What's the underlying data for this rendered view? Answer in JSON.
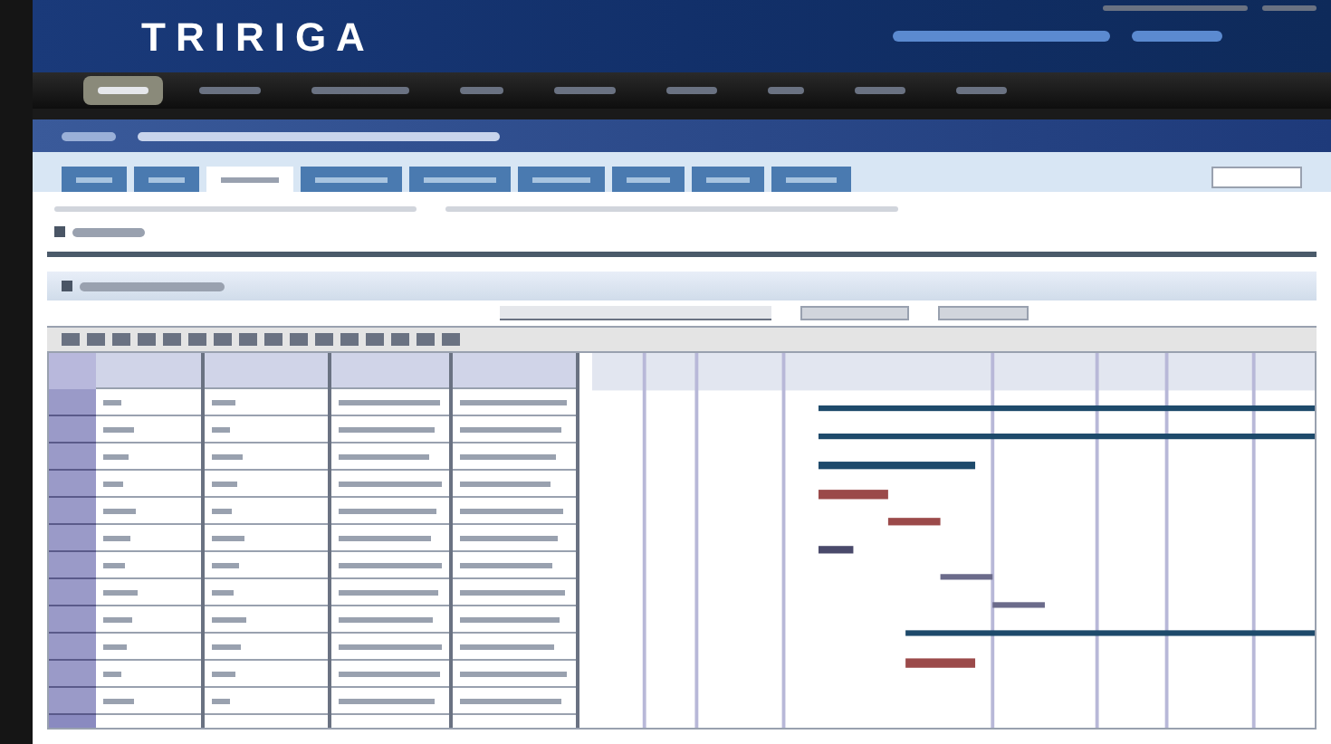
{
  "header": {
    "logo": "TRIRIGA"
  },
  "nav": {
    "items": [
      {
        "selected": true
      },
      {
        "selected": false
      },
      {
        "selected": false
      },
      {
        "selected": false
      },
      {
        "selected": false
      },
      {
        "selected": false
      },
      {
        "selected": false
      },
      {
        "selected": false
      },
      {
        "selected": false
      }
    ]
  },
  "tabs": [
    {
      "selected": false
    },
    {
      "selected": false
    },
    {
      "selected": true
    },
    {
      "selected": false
    },
    {
      "selected": false
    },
    {
      "selected": false
    },
    {
      "selected": false
    },
    {
      "selected": false
    },
    {
      "selected": false
    }
  ]
}
